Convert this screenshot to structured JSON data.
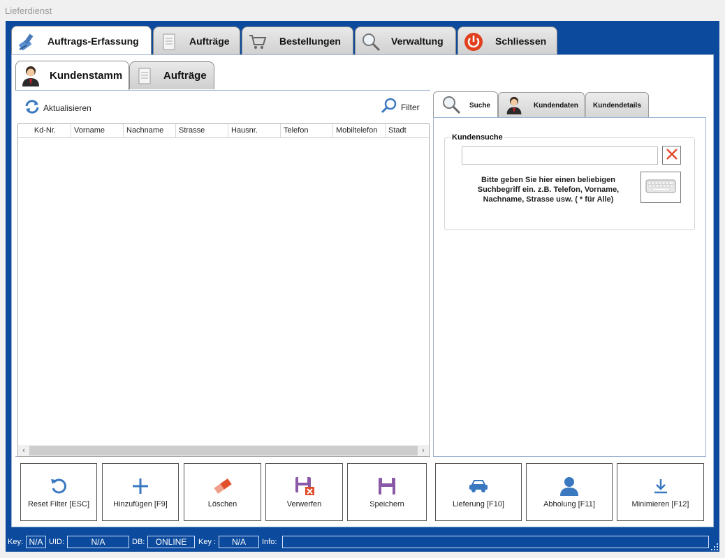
{
  "window": {
    "title": "Lieferdienst"
  },
  "main_tabs": [
    {
      "label": "Auftrags-Erfassung",
      "icon": "brush-icon"
    },
    {
      "label": "Aufträge",
      "icon": "receipt-icon"
    },
    {
      "label": "Bestellungen",
      "icon": "cart-icon"
    },
    {
      "label": "Verwaltung",
      "icon": "magnifier-icon"
    },
    {
      "label": "Schliessen",
      "icon": "power-icon"
    }
  ],
  "sub_tabs": [
    {
      "label": "Kundenstamm",
      "icon": "person-icon"
    },
    {
      "label": "Aufträge",
      "icon": "receipt-icon"
    }
  ],
  "toolbar": {
    "refresh_label": "Aktualisieren",
    "filter_label": "Filter"
  },
  "grid": {
    "columns": [
      "Kd-Nr.",
      "Vorname",
      "Nachname",
      "Strasse",
      "Hausnr.",
      "Telefon",
      "Mobiltelefon",
      "Stadt"
    ],
    "rows": []
  },
  "right_tabs": [
    {
      "label": "Suche",
      "icon": "magnifier-icon"
    },
    {
      "label": "Kundendaten",
      "icon": "person-icon"
    },
    {
      "label": "Kundendetails",
      "icon": ""
    }
  ],
  "search": {
    "group_title": "Kundensuche",
    "value": "",
    "hint": "Bitte geben Sie hier einen beliebigen Suchbegriff ein. z.B. Telefon, Vorname, Nachname, Strasse usw. ( * für Alle)"
  },
  "actions": [
    {
      "label": "Reset Filter [ESC]",
      "icon": "reset-icon"
    },
    {
      "label": "Hinzufügen [F9]",
      "icon": "plus-icon"
    },
    {
      "label": "Löschen",
      "icon": "eraser-icon"
    },
    {
      "label": "Verwerfen",
      "icon": "discard-icon"
    },
    {
      "label": "Speichern",
      "icon": "save-icon"
    },
    {
      "label": "Lieferung [F10]",
      "icon": "car-icon"
    },
    {
      "label": "Abholung [F11]",
      "icon": "user-icon"
    },
    {
      "label": "Minimieren [F12]",
      "icon": "download-icon"
    }
  ],
  "status": {
    "key_label": "Key:",
    "key_value": "N/A",
    "uid_label": "UID:",
    "uid_value": "N/A",
    "db_label": "DB:",
    "db_value": "ONLINE",
    "key2_label": "Key :",
    "key2_value": "N/A",
    "info_label": "Info:",
    "info_value": ""
  },
  "colors": {
    "frame": "#0b4a9c",
    "accent_blue": "#3a78c0",
    "purple": "#8a5aa8",
    "danger": "#e04a2a"
  }
}
